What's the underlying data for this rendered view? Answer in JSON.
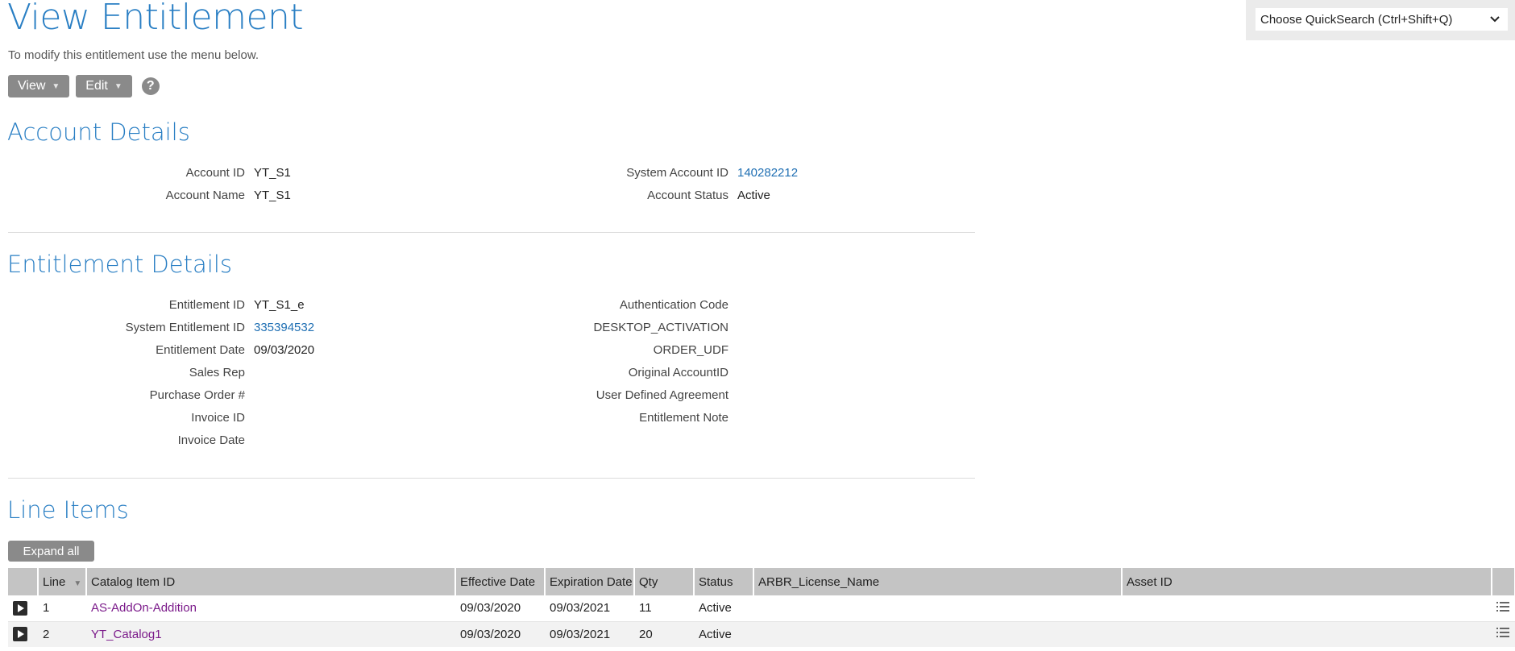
{
  "header": {
    "title": "View Entitlement",
    "subtitle": "To modify this entitlement use the menu below.",
    "view_label": "View",
    "edit_label": "Edit",
    "help_glyph": "?"
  },
  "quicksearch": {
    "placeholder": "Choose QuickSearch (Ctrl+Shift+Q)"
  },
  "account": {
    "title": "Account Details",
    "fields": [
      {
        "label": "Account ID",
        "value": "YT_S1"
      },
      {
        "label": "Account Name",
        "value": "YT_S1"
      },
      {
        "label": "System Account ID",
        "value": "140282212"
      },
      {
        "label": "Account Status",
        "value": "Active"
      }
    ]
  },
  "entitlement": {
    "title": "Entitlement Details",
    "left": [
      {
        "label": "Entitlement ID",
        "value": "YT_S1_e"
      },
      {
        "label": "System Entitlement ID",
        "value": "335394532"
      },
      {
        "label": "Entitlement Date",
        "value": "09/03/2020"
      },
      {
        "label": "Sales Rep",
        "value": ""
      },
      {
        "label": "Purchase Order #",
        "value": ""
      },
      {
        "label": "Invoice ID",
        "value": ""
      },
      {
        "label": "Invoice Date",
        "value": ""
      }
    ],
    "right": [
      {
        "label": "Authentication Code",
        "value": ""
      },
      {
        "label": "DESKTOP_ACTIVATION",
        "value": ""
      },
      {
        "label": "ORDER_UDF",
        "value": ""
      },
      {
        "label": "Original AccountID",
        "value": ""
      },
      {
        "label": "User Defined Agreement",
        "value": ""
      },
      {
        "label": "Entitlement Note",
        "value": ""
      }
    ]
  },
  "line_items": {
    "title": "Line Items",
    "expand_label": "Expand all",
    "columns": [
      "Line",
      "Catalog Item ID",
      "Effective Date",
      "Expiration Date",
      "Qty",
      "Status",
      "ARBR_License_Name",
      "Asset ID"
    ],
    "rows": [
      {
        "line": "1",
        "catalog": "AS-AddOn-Addition",
        "effective": "09/03/2020",
        "expiration": "09/03/2021",
        "qty": "11",
        "status": "Active",
        "license": "",
        "asset": ""
      },
      {
        "line": "2",
        "catalog": "YT_Catalog1",
        "effective": "09/03/2020",
        "expiration": "09/03/2021",
        "qty": "20",
        "status": "Active",
        "license": "",
        "asset": ""
      }
    ]
  },
  "icons": {
    "view_caret": "caret-down-icon",
    "edit_caret": "caret-down-icon",
    "help": "help-icon",
    "quicksearch_chevron": "chevron-down-icon",
    "expand_row": "play-icon",
    "row_menu": "list-icon",
    "sort": "sort-desc-icon"
  },
  "colors": {
    "accent": "#2a7fc4",
    "link": "#1f6fb3",
    "catalog_link": "#7b1a8a",
    "button": "#8a8a8a"
  }
}
